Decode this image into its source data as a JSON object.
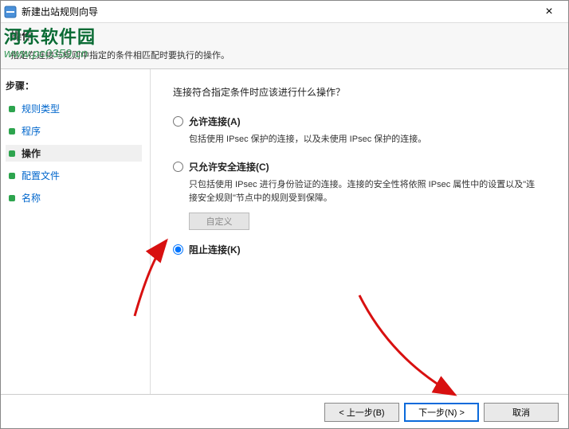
{
  "titlebar": {
    "title": "新建出站规则向导",
    "close": "×"
  },
  "watermark": {
    "text": "河东软件园",
    "url": "www.pc0359.cn"
  },
  "header": {
    "page_title": "操作",
    "page_desc": "指定在连接与规则中指定的条件相匹配时要执行的操作。"
  },
  "sidebar": {
    "steps_label": "步骤：",
    "items": [
      {
        "label": "规则类型"
      },
      {
        "label": "程序"
      },
      {
        "label": "操作"
      },
      {
        "label": "配置文件"
      },
      {
        "label": "名称"
      }
    ],
    "current_index": 2
  },
  "main": {
    "question": "连接符合指定条件时应该进行什么操作？",
    "options": [
      {
        "key": "allow",
        "label": "允许连接(A)",
        "desc": "包括使用 IPsec 保护的连接，以及未使用 IPsec 保护的连接。",
        "checked": false
      },
      {
        "key": "secure",
        "label": "只允许安全连接(C)",
        "desc": "只包括使用 IPsec 进行身份验证的连接。连接的安全性将依照 IPsec 属性中的设置以及\"连接安全规则\"节点中的规则受到保障。",
        "checked": false,
        "has_custom": true,
        "custom_label": "自定义"
      },
      {
        "key": "block",
        "label": "阻止连接(K)",
        "desc": "",
        "checked": true
      }
    ]
  },
  "footer": {
    "back": "< 上一步(B)",
    "next": "下一步(N) >",
    "cancel": "取消"
  }
}
